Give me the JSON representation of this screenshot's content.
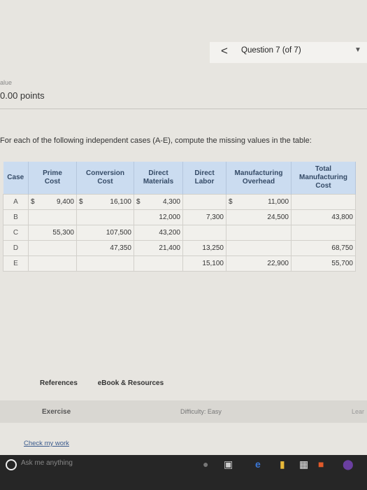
{
  "header": {
    "prev_arrow": "<",
    "question_label": "Question 7 (of 7)",
    "dropdown_caret": "▼"
  },
  "value": {
    "label": "alue",
    "points": "0.00 points"
  },
  "prompt": "For each of the following independent cases (A-E), compute the missing values in the table:",
  "table": {
    "headers": [
      "Case",
      "Prime\nCost",
      "Conversion\nCost",
      "Direct\nMaterials",
      "Direct\nLabor",
      "Manufacturing\nOverhead",
      "Total\nManufacturing\nCost"
    ],
    "rows": [
      {
        "case": "A",
        "prime_prefix": "$",
        "prime": "9,400",
        "conversion_prefix": "$",
        "conversion": "16,100",
        "materials_prefix": "$",
        "materials": "4,300",
        "labor_prefix": "",
        "labor": "",
        "overhead_prefix": "$",
        "overhead": "11,000",
        "total_prefix": "",
        "total": ""
      },
      {
        "case": "B",
        "prime_prefix": "",
        "prime": "",
        "conversion_prefix": "",
        "conversion": "",
        "materials_prefix": "",
        "materials": "12,000",
        "labor_prefix": "",
        "labor": "7,300",
        "overhead_prefix": "",
        "overhead": "24,500",
        "total_prefix": "",
        "total": "43,800"
      },
      {
        "case": "C",
        "prime_prefix": "",
        "prime": "55,300",
        "conversion_prefix": "",
        "conversion": "107,500",
        "materials_prefix": "",
        "materials": "43,200",
        "labor_prefix": "",
        "labor": "",
        "overhead_prefix": "",
        "overhead": "",
        "total_prefix": "",
        "total": ""
      },
      {
        "case": "D",
        "prime_prefix": "",
        "prime": "",
        "conversion_prefix": "",
        "conversion": "47,350",
        "materials_prefix": "",
        "materials": "21,400",
        "labor_prefix": "",
        "labor": "13,250",
        "overhead_prefix": "",
        "overhead": "",
        "total_prefix": "",
        "total": "68,750"
      },
      {
        "case": "E",
        "prime_prefix": "",
        "prime": "",
        "conversion_prefix": "",
        "conversion": "",
        "materials_prefix": "",
        "materials": "",
        "labor_prefix": "",
        "labor": "15,100",
        "overhead_prefix": "",
        "overhead": "22,900",
        "total_prefix": "",
        "total": "55,700"
      }
    ]
  },
  "links": {
    "references": "References",
    "ebook": "eBook & Resources"
  },
  "footer": {
    "exercise": "Exercise",
    "difficulty": "Difficulty: Easy",
    "learn": "Lear"
  },
  "check_work": "Check my work",
  "taskbar": {
    "search_placeholder": "Ask me anything"
  },
  "colors": {
    "header_bg": "#cbdcf0",
    "input_bg": "#fbf7cf",
    "cell_bg": "#f1f0ec"
  }
}
